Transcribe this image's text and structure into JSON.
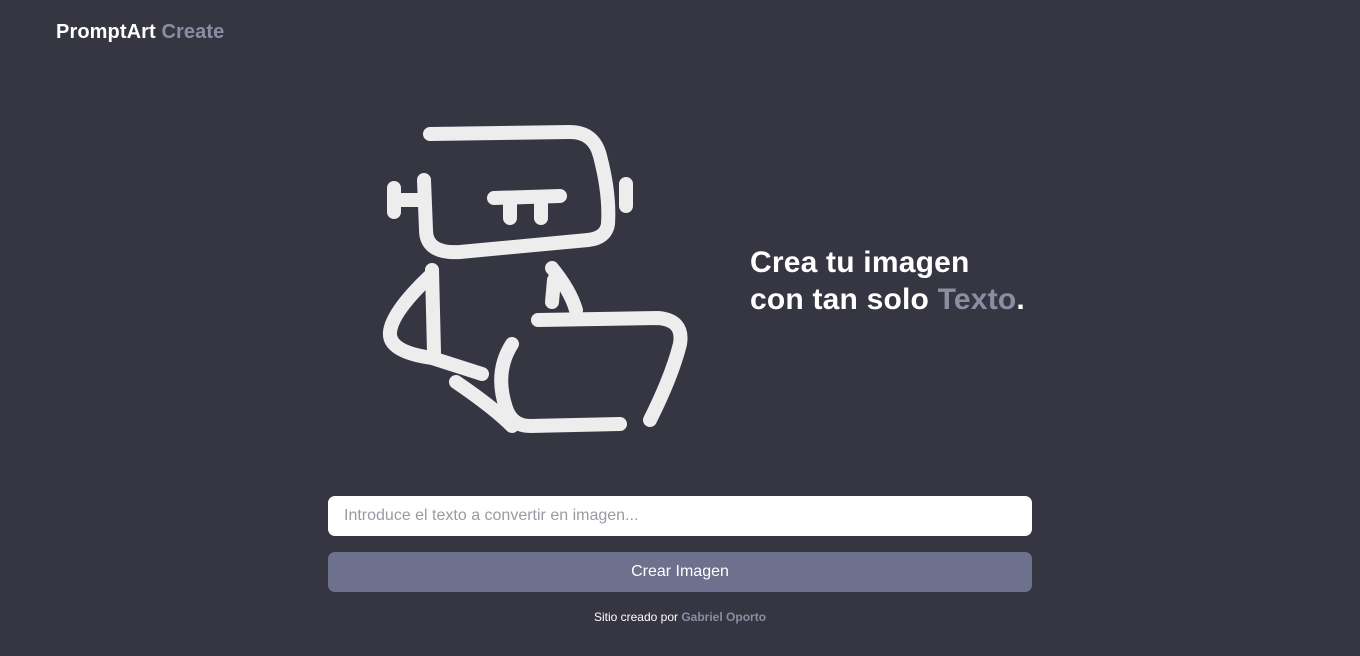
{
  "brand": {
    "name": "PromptArt",
    "suffix": "Create"
  },
  "hero": {
    "line1": "Crea tu imagen",
    "line2_prefix": "con tan solo",
    "line2_accent": "Texto",
    "line2_suffix": "."
  },
  "form": {
    "placeholder": "Introduce el texto a convertir en imagen...",
    "value": "",
    "button_label": "Crear Imagen"
  },
  "footer": {
    "prefix": "Sitio creado por",
    "author": "Gabriel Oporto"
  },
  "colors": {
    "background": "#363542",
    "accent": "#8e8ca3",
    "button": "#6e718d",
    "input": "#ffffff",
    "text": "#ffffff"
  },
  "illustration": {
    "icon": "robot-with-laptop-icon"
  }
}
